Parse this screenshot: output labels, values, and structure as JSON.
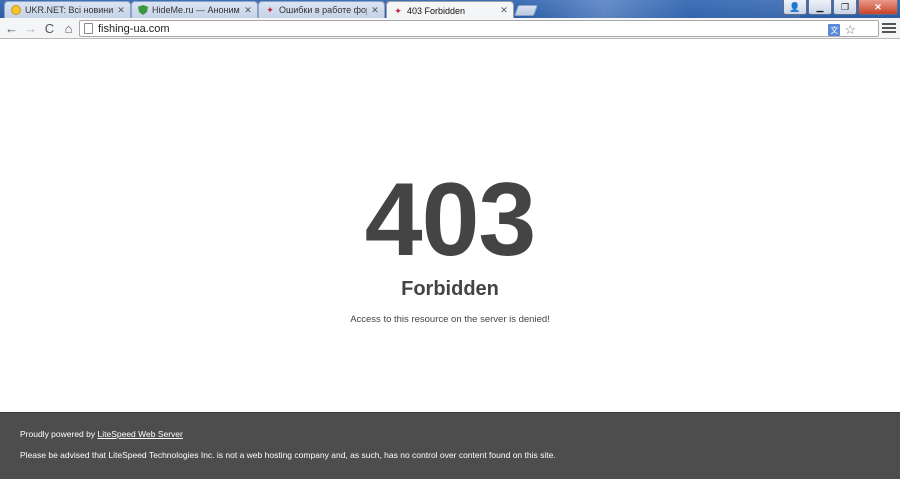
{
  "browser": {
    "tabs": [
      {
        "title": "UKR.NET: Всі новини Укра",
        "icon": "ukrnet-favicon-icon",
        "active": false
      },
      {
        "title": "HideMe.ru — Анонимайз",
        "icon": "shield-favicon-icon",
        "active": false
      },
      {
        "title": "Ошибки в работе форум",
        "icon": "red-favicon-icon",
        "active": false
      },
      {
        "title": "403 Forbidden",
        "icon": "red-favicon-icon",
        "active": true
      }
    ],
    "close_glyph": "✕",
    "window_buttons": {
      "minimize": "▁",
      "maximize": "❐",
      "close": "✕",
      "user": "👤"
    },
    "address": "fishing-ua.com",
    "back_glyph": "←",
    "forward_glyph": "→",
    "reload_glyph": "C",
    "home_glyph": "⌂",
    "translate_glyph": "文",
    "star_glyph": "☆"
  },
  "page": {
    "code": "403",
    "title": "Forbidden",
    "message": "Access to this resource on the server is denied!"
  },
  "footer": {
    "powered_prefix": "Proudly powered by ",
    "powered_link": "LiteSpeed Web Server",
    "disclaimer": "Please be advised that LiteSpeed Technologies Inc. is not a web hosting company and, as such, has no control over content found on this site."
  }
}
